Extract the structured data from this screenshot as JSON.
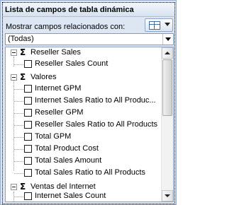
{
  "panel": {
    "title": "Lista de campos de tabla dinámica",
    "close_glyph": "✕"
  },
  "related": {
    "label": "Mostrar campos relacionados con:",
    "dropdown_value": "(Todas)"
  },
  "icons": {
    "layout_button": "field-list-layout-icon",
    "sigma": "Σ"
  },
  "groups": [
    {
      "name": "Reseller Sales",
      "items": [
        "Reseller Sales Count"
      ]
    },
    {
      "name": "Valores",
      "items": [
        "Internet GPM",
        "Internet Sales Ratio to All Produc...",
        "Reseller GPM",
        "Reseller Sales Ratio to All Products",
        "Total GPM",
        "Total Product Cost",
        "Total Sales Amount",
        "Total Sales Ratio to All Products"
      ]
    },
    {
      "name": "Ventas del Internet",
      "items": [
        "Internet Sales Count"
      ]
    }
  ]
}
